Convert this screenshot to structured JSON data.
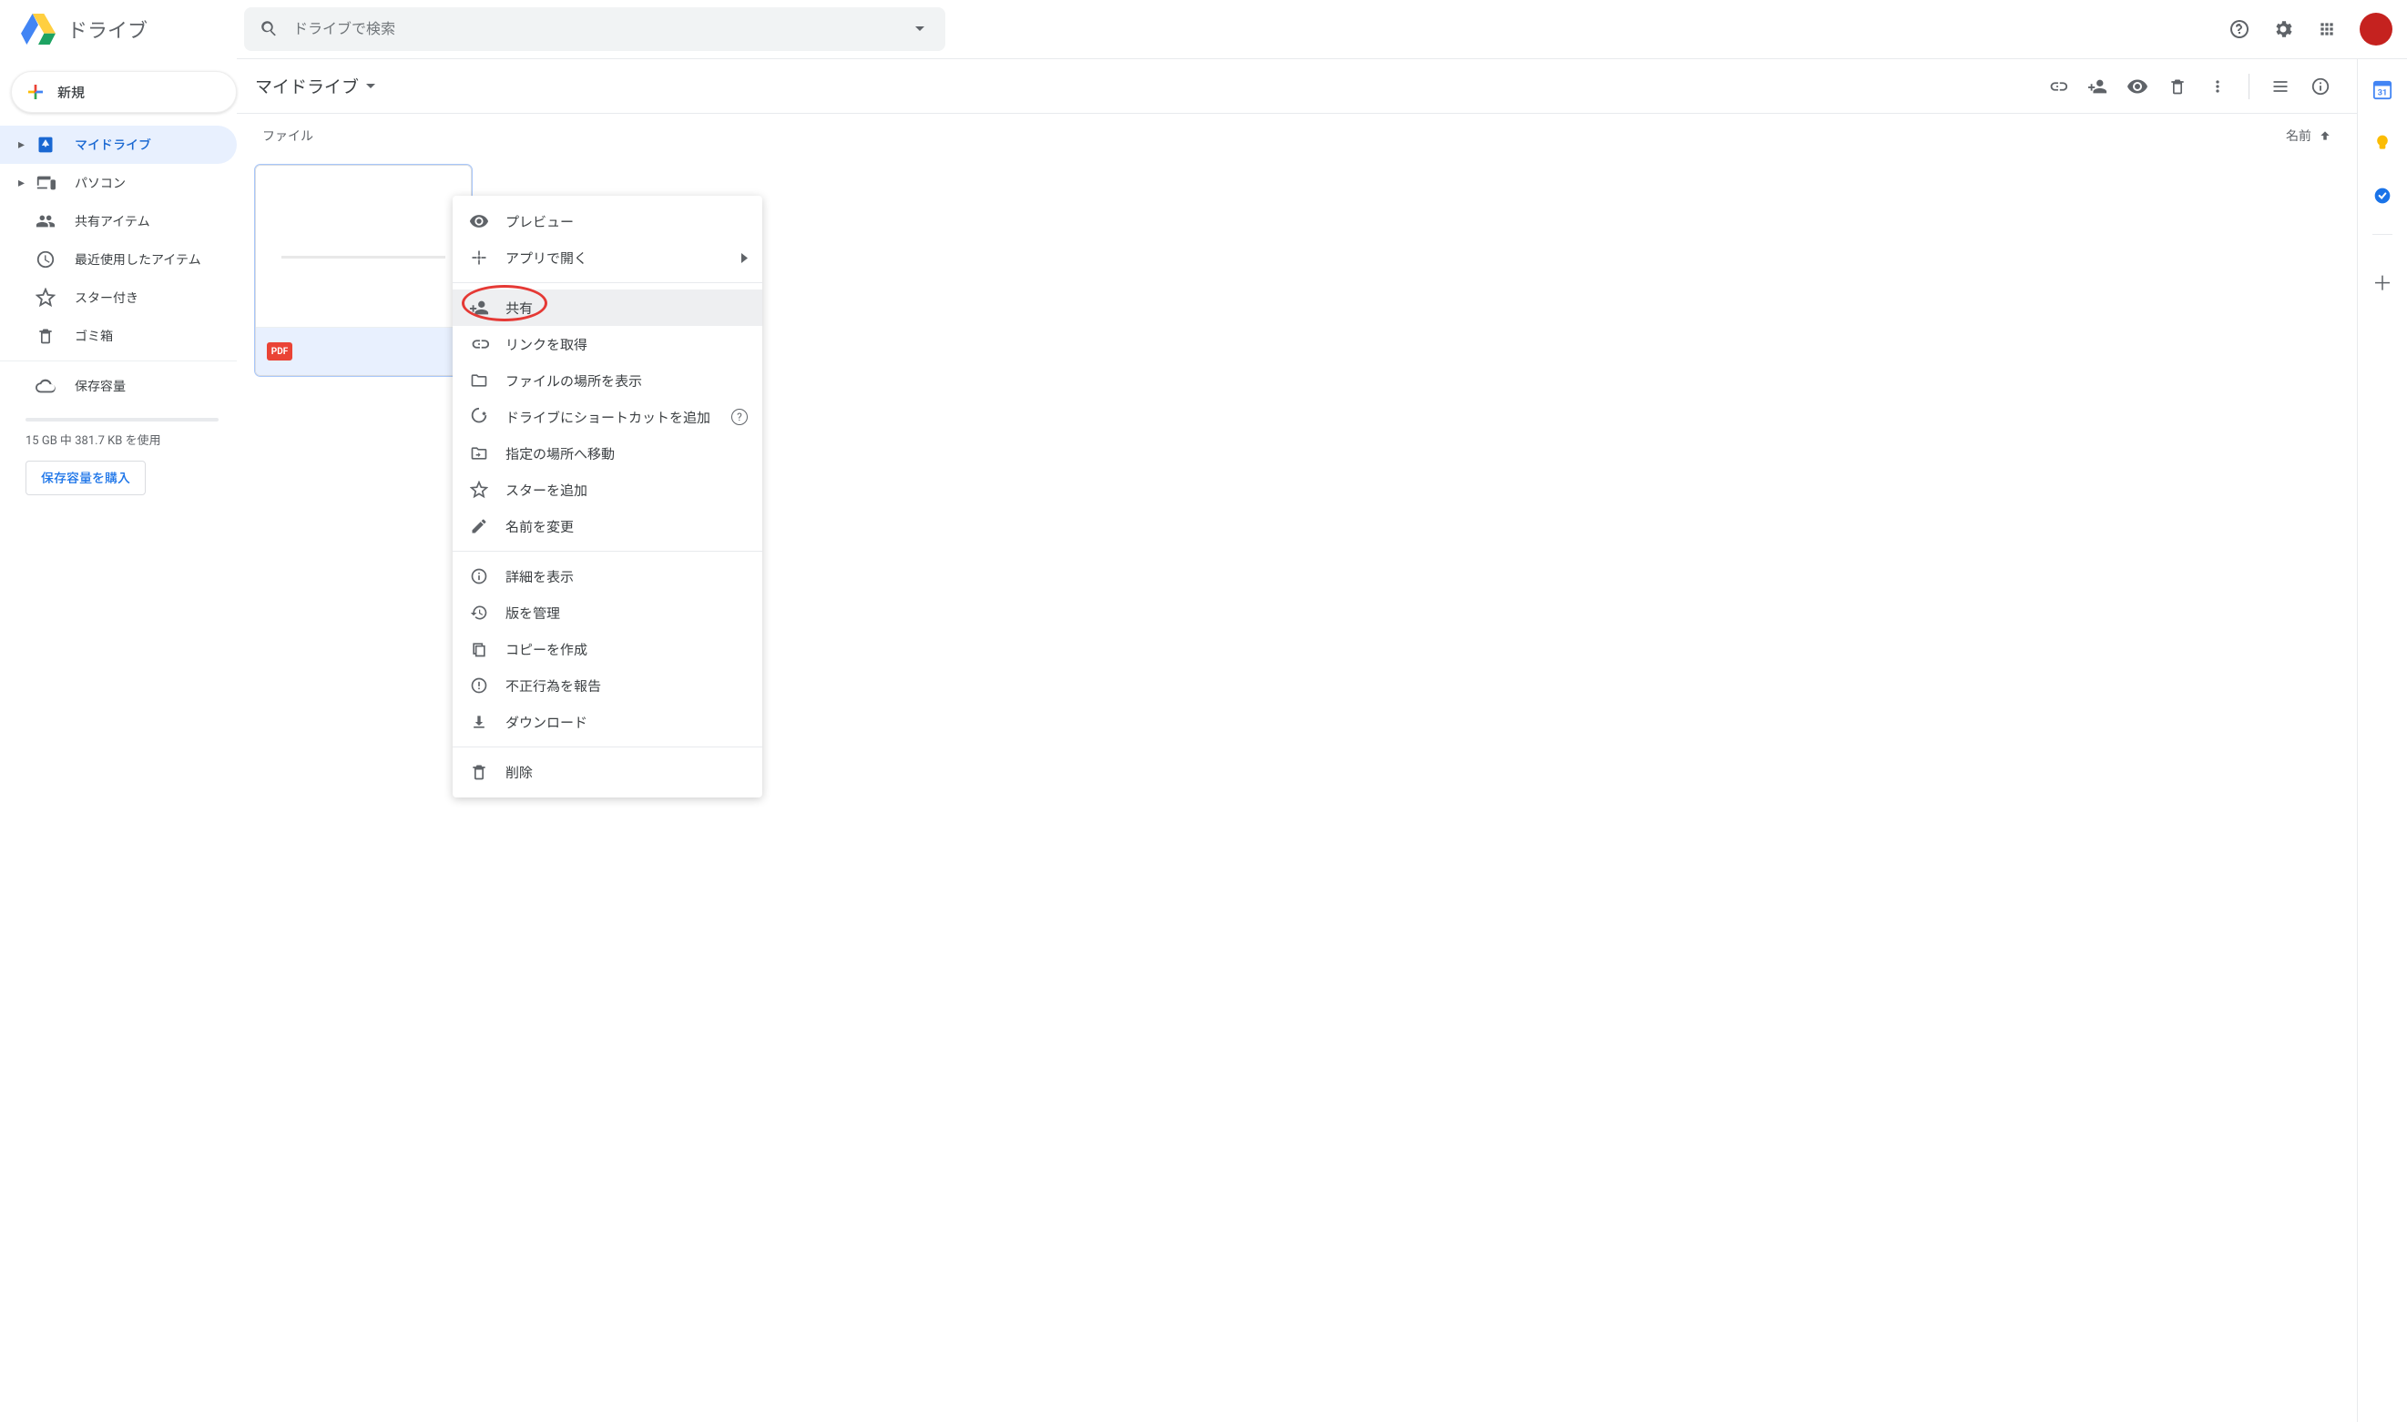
{
  "header": {
    "app_name": "ドライブ",
    "search_placeholder": "ドライブで検索"
  },
  "sidebar": {
    "new_label": "新規",
    "items": [
      {
        "label": "マイドライブ"
      },
      {
        "label": "パソコン"
      },
      {
        "label": "共有アイテム"
      },
      {
        "label": "最近使用したアイテム"
      },
      {
        "label": "スター付き"
      },
      {
        "label": "ゴミ箱"
      }
    ],
    "storage_label": "保存容量",
    "usage_text": "15 GB 中 381.7 KB を使用",
    "buy_label": "保存容量を購入"
  },
  "main": {
    "path_title": "マイドライブ",
    "section_label": "ファイル",
    "sort_label": "名前",
    "file_badge": "PDF"
  },
  "context_menu": {
    "items": [
      {
        "icon": "eye",
        "label": "プレビュー"
      },
      {
        "icon": "open",
        "label": "アプリで開く",
        "arrow": true
      },
      {
        "sep": true
      },
      {
        "icon": "person-add",
        "label": "共有",
        "hover": true
      },
      {
        "icon": "link",
        "label": "リンクを取得"
      },
      {
        "icon": "folder",
        "label": "ファイルの場所を表示"
      },
      {
        "icon": "shortcut",
        "label": "ドライブにショートカットを追加",
        "help": true
      },
      {
        "icon": "move",
        "label": "指定の場所へ移動"
      },
      {
        "icon": "star",
        "label": "スターを追加"
      },
      {
        "icon": "rename",
        "label": "名前を変更"
      },
      {
        "sep": true
      },
      {
        "icon": "info",
        "label": "詳細を表示"
      },
      {
        "icon": "history",
        "label": "版を管理"
      },
      {
        "icon": "copy",
        "label": "コピーを作成"
      },
      {
        "icon": "report",
        "label": "不正行為を報告"
      },
      {
        "icon": "download",
        "label": "ダウンロード"
      },
      {
        "sep": true
      },
      {
        "icon": "trash",
        "label": "削除"
      }
    ]
  },
  "right_rail": {
    "calendar_day": "31"
  }
}
